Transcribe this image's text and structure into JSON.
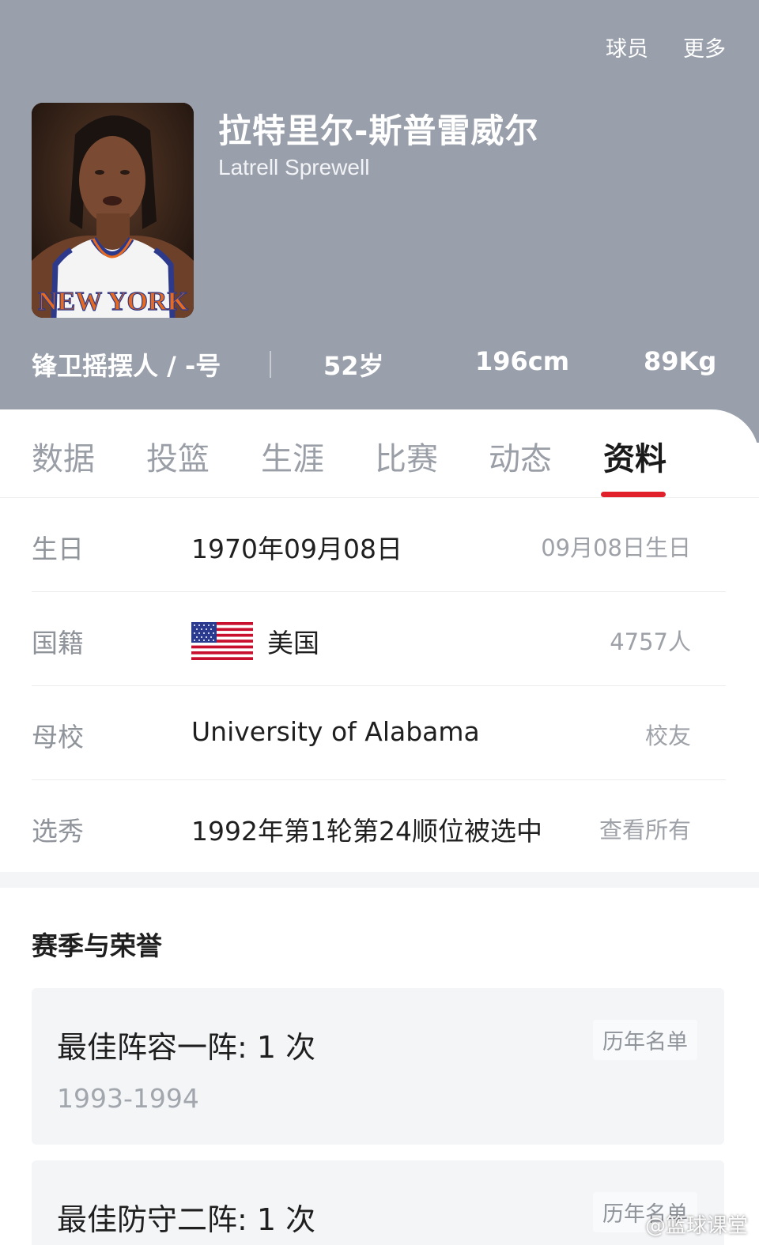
{
  "top_nav": {
    "players": "球员",
    "more": "更多"
  },
  "player": {
    "name_cn": "拉特里尔-斯普雷威尔",
    "name_en": "Latrell Sprewell",
    "position_number": "锋卫摇摆人 / -号",
    "age": "52岁",
    "height": "196cm",
    "weight": "89Kg",
    "jersey_text": "NEW YORK"
  },
  "tabs": [
    {
      "label": "数据",
      "active": false
    },
    {
      "label": "投篮",
      "active": false
    },
    {
      "label": "生涯",
      "active": false
    },
    {
      "label": "比赛",
      "active": false
    },
    {
      "label": "动态",
      "active": false
    },
    {
      "label": "资料",
      "active": true
    }
  ],
  "info": {
    "birthday": {
      "label": "生日",
      "value": "1970年09月08日",
      "right": "09月08日生日"
    },
    "nationality": {
      "label": "国籍",
      "value": "美国",
      "right": "4757人"
    },
    "college": {
      "label": "母校",
      "value": "University of Alabama",
      "right": "校友"
    },
    "draft": {
      "label": "选秀",
      "value": "1992年第1轮第24顺位被选中",
      "right": "查看所有"
    }
  },
  "honors": {
    "title": "赛季与荣誉",
    "items": [
      {
        "title": "最佳阵容一阵: 1 次",
        "years": "1993-1994",
        "button": "历年名单"
      },
      {
        "title": "最佳防守二阵: 1 次",
        "years": "",
        "button": "历年名单"
      }
    ]
  },
  "watermark": "@篮球课堂",
  "colors": {
    "header_bg": "#9aa0ab",
    "accent_red": "#e0212b",
    "card_bg": "#f4f5f7",
    "muted_text": "#9a9ea6"
  }
}
